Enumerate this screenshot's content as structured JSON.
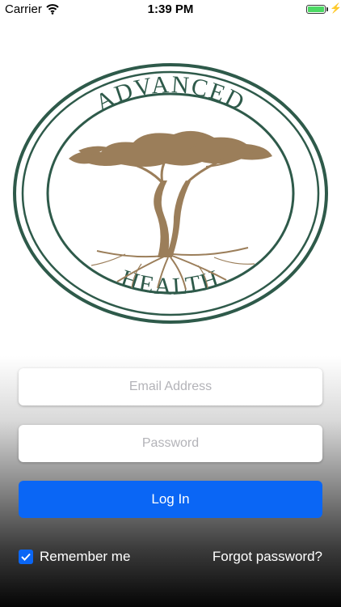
{
  "status_bar": {
    "carrier": "Carrier",
    "time": "1:39 PM"
  },
  "logo": {
    "top_text": "ADVANCED",
    "bottom_text": "HEALTH",
    "ring_color": "#2e5a4a",
    "tree_color": "#9b7e5a"
  },
  "form": {
    "email_placeholder": "Email Address",
    "email_value": "",
    "password_placeholder": "Password",
    "password_value": "",
    "login_label": "Log In",
    "remember_label": "Remember me",
    "remember_checked": true,
    "forgot_label": "Forgot password?"
  },
  "colors": {
    "accent": "#0a66f5",
    "battery": "#4cd964"
  }
}
